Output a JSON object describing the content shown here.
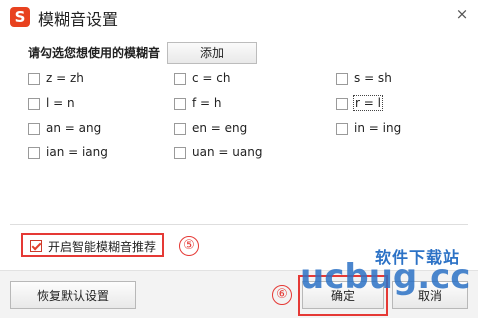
{
  "window": {
    "logo_glyph": "S",
    "title": "模糊音设置",
    "close_glyph": "×"
  },
  "prompt": "请勾选您想使用的模糊音",
  "add_label": "添加",
  "options": [
    {
      "label": "z = zh",
      "checked": false
    },
    {
      "label": "c = ch",
      "checked": false
    },
    {
      "label": "s = sh",
      "checked": false
    },
    {
      "label": "l = n",
      "checked": false
    },
    {
      "label": "f = h",
      "checked": false
    },
    {
      "label": "r = l",
      "checked": false,
      "focused": true
    },
    {
      "label": "an = ang",
      "checked": false
    },
    {
      "label": "en = eng",
      "checked": false
    },
    {
      "label": "in = ing",
      "checked": false
    },
    {
      "label": "ian = iang",
      "checked": false
    },
    {
      "label": "uan = uang",
      "checked": false
    }
  ],
  "smart": {
    "label": "开启智能模糊音推荐",
    "checked": true
  },
  "markers": {
    "five": "⑤",
    "six": "⑥"
  },
  "footer": {
    "restore_label": "恢复默认设置",
    "ok_label": "确定",
    "cancel_label": "取消"
  },
  "watermark": {
    "text": "软件下载站",
    "logo": "ucbug.cc"
  },
  "colors": {
    "accent": "#e53935",
    "brand": "#e8421f",
    "watermark": "#2c72c6"
  }
}
